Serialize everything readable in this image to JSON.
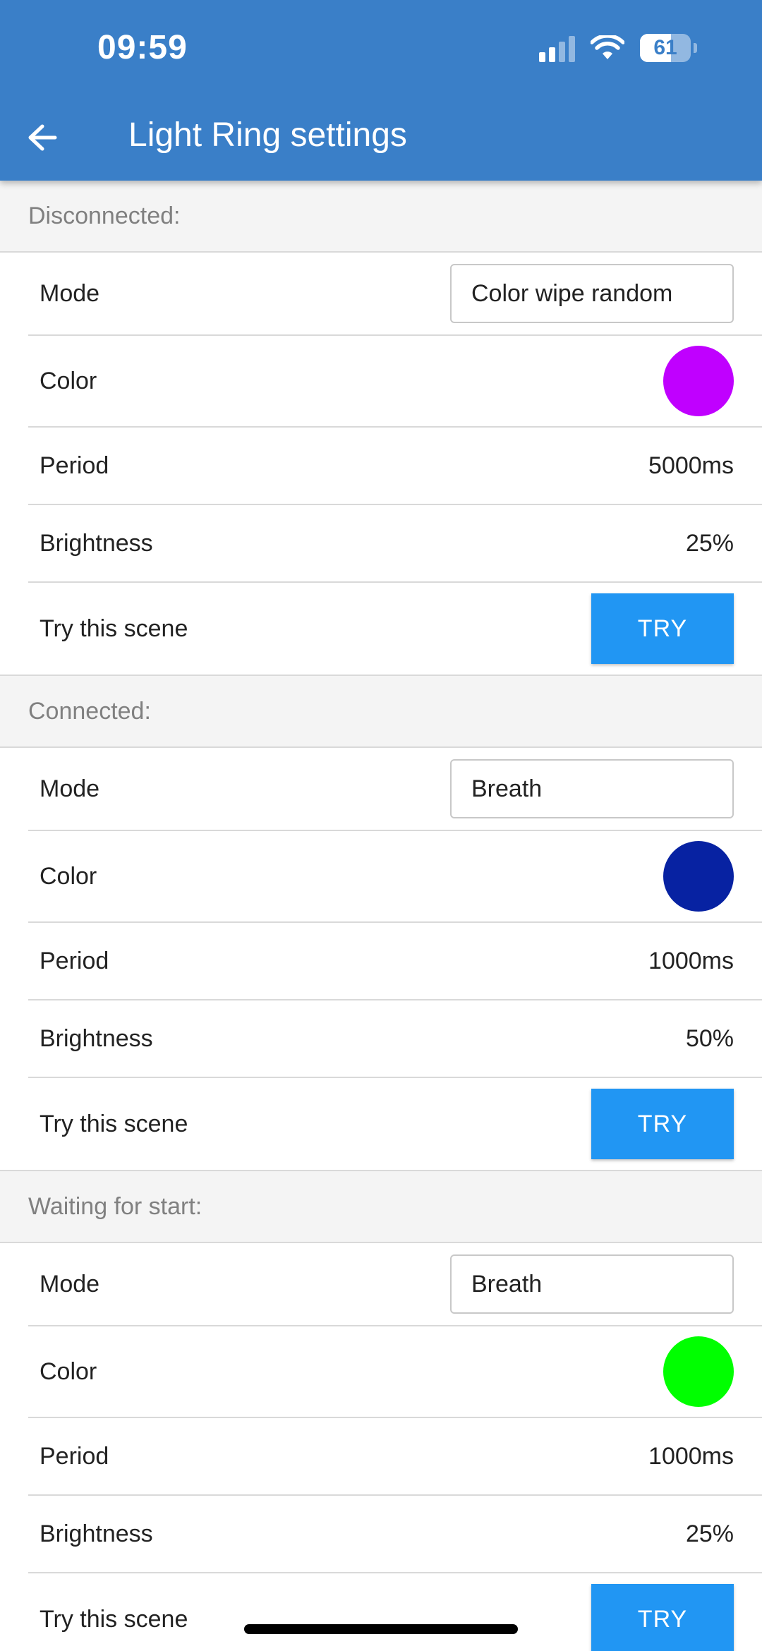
{
  "status_bar": {
    "time": "09:59",
    "battery_level": "61",
    "battery_fraction": 0.61,
    "signal_bars_active": 2,
    "signal_bars_total": 4
  },
  "app_bar": {
    "title": "Light Ring settings",
    "back_icon": "arrow-left-icon",
    "background_color": "#3a7fc8"
  },
  "labels": {
    "mode": "Mode",
    "color": "Color",
    "period": "Period",
    "brightness": "Brightness",
    "try_scene": "Try this scene",
    "try_button": "TRY"
  },
  "sections": [
    {
      "title": "Disconnected:",
      "mode": "Color wipe random",
      "color": "#c000ff",
      "period": "5000ms",
      "brightness": "25%"
    },
    {
      "title": "Connected:",
      "mode": "Breath",
      "color": "#0722a2",
      "period": "1000ms",
      "brightness": "50%"
    },
    {
      "title": "Waiting for start:",
      "mode": "Breath",
      "color": "#00ff00",
      "period": "1000ms",
      "brightness": "25%"
    }
  ],
  "colors": {
    "accent_button": "#2196f3",
    "section_header_bg": "#f4f4f4",
    "section_header_text": "#808080"
  }
}
